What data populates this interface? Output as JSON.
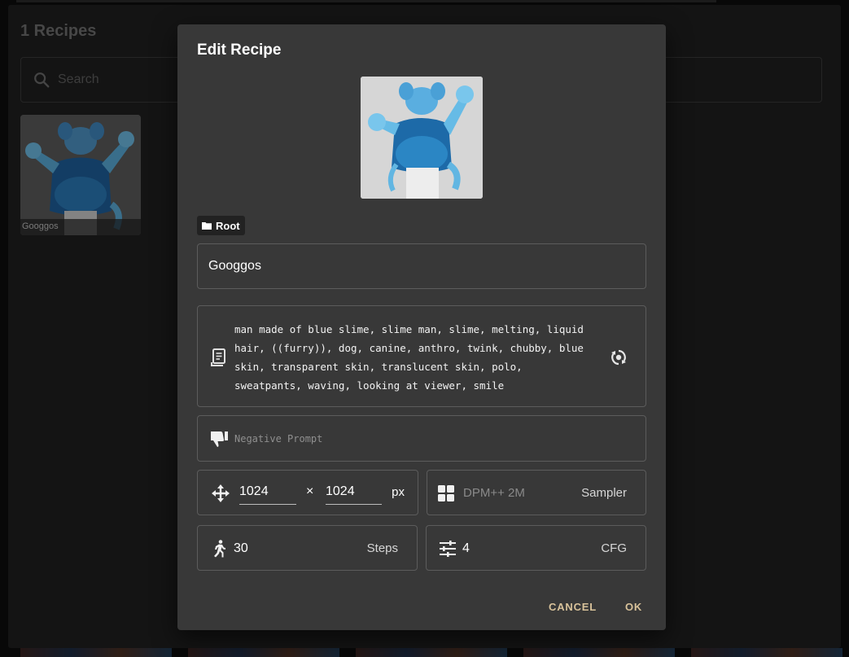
{
  "background": {
    "title": "1 Recipes",
    "search": {
      "placeholder": "Search"
    },
    "recipe_card": {
      "caption": "Googgos"
    }
  },
  "dialog": {
    "title": "Edit Recipe",
    "folder_chip": "Root",
    "name_value": "Googgos",
    "prompt": "man made of blue slime, slime man, slime, melting, liquid hair, ((furry)), dog, canine, anthro, twink, chubby, blue skin, transparent skin, translucent skin, polo, sweatpants, waving, looking at viewer, smile",
    "negative_prompt_placeholder": "Negative Prompt",
    "size": {
      "width": "1024",
      "height": "1024",
      "separator": "×",
      "unit": "px"
    },
    "sampler": {
      "value": "DPM++ 2M",
      "label": "Sampler"
    },
    "steps": {
      "value": "30",
      "label": "Steps"
    },
    "cfg": {
      "value": "4",
      "label": "CFG"
    },
    "buttons": {
      "cancel": "CANCEL",
      "ok": "OK"
    }
  },
  "colors": {
    "dialog_bg": "#383838",
    "accent_button_text": "#d8c29a",
    "field_border": "#5c5c5c"
  },
  "icons": [
    "search-icon",
    "folder-icon",
    "prompt-scroll-icon",
    "regenerate-icon",
    "thumbs-down-icon",
    "move-arrows-icon",
    "grid-icon",
    "running-person-icon",
    "tune-sliders-icon"
  ]
}
